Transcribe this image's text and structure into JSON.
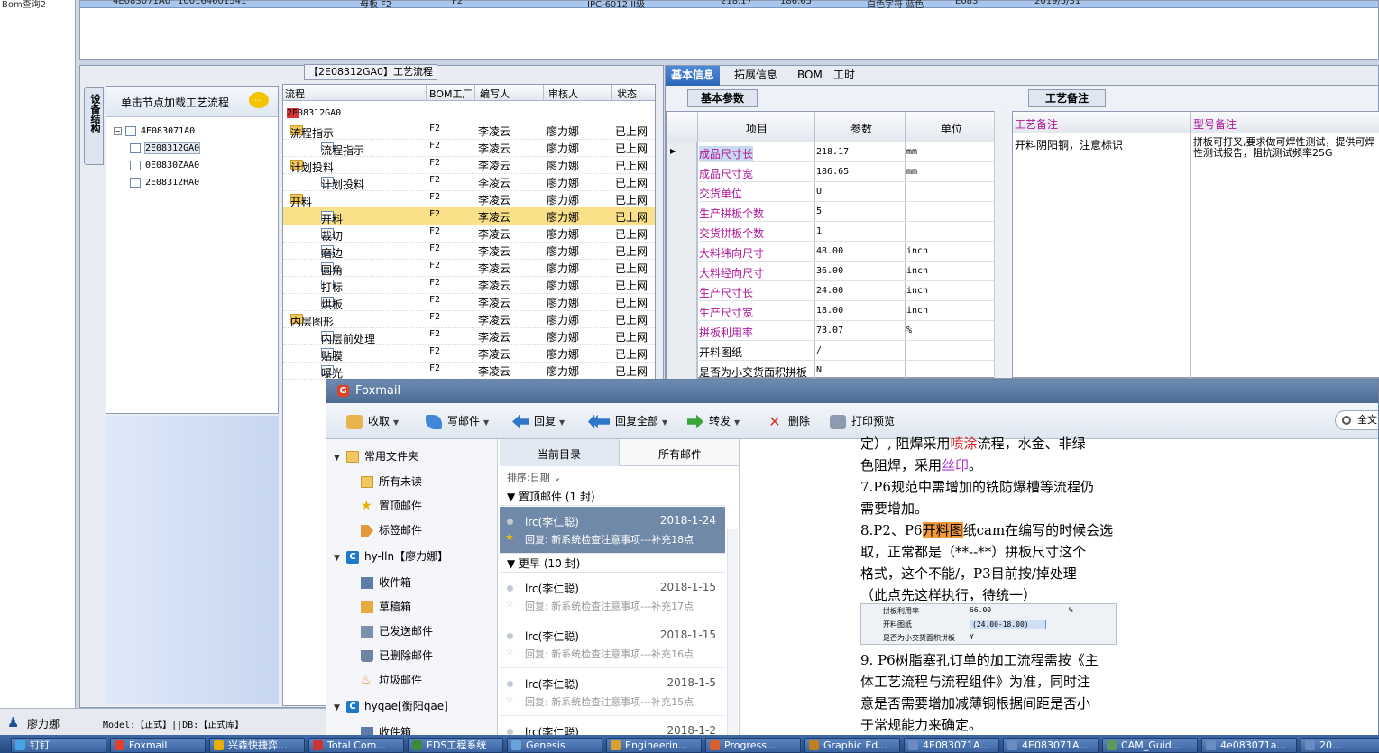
{
  "left_nav": {
    "label": "Bom查询2"
  },
  "top_grid": {
    "row": [
      "4E083071A0",
      "100164601541",
      "母板  F2",
      "F2",
      "IPC-6012 II级",
      "218.17",
      "186.65",
      "白色字符  蓝色",
      "E083",
      "2019/5/31"
    ]
  },
  "process_panel": {
    "title": "【2E08312GA0】工艺流程",
    "side_tab": "设备结构",
    "tree_header": "单击节点加载工艺流程",
    "tree_nodes": [
      "4E083071A0",
      "2E08312GA0",
      "0E0830ZAA0",
      "2E08312HA0"
    ],
    "grid_headers": [
      "流程",
      "BOM工厂",
      "编写人",
      "审核人",
      "状态"
    ],
    "root": "2E08312GA0",
    "rows": [
      {
        "name": "流程指示",
        "bom": "F2",
        "writer": "李凌云",
        "reviewer": "廖力娜",
        "status": "已上网",
        "kind": "folder",
        "level": 1
      },
      {
        "name": "流程指示",
        "bom": "F2",
        "writer": "李凌云",
        "reviewer": "廖力娜",
        "status": "已上网",
        "kind": "doc",
        "level": 2
      },
      {
        "name": "计划投料",
        "bom": "F2",
        "writer": "李凌云",
        "reviewer": "廖力娜",
        "status": "已上网",
        "kind": "folder",
        "level": 1
      },
      {
        "name": "计划投料",
        "bom": "F2",
        "writer": "李凌云",
        "reviewer": "廖力娜",
        "status": "已上网",
        "kind": "doc",
        "level": 2
      },
      {
        "name": "开料",
        "bom": "F2",
        "writer": "李凌云",
        "reviewer": "廖力娜",
        "status": "已上网",
        "kind": "folder",
        "level": 1
      },
      {
        "name": "开料",
        "bom": "F2",
        "writer": "李凌云",
        "reviewer": "廖力娜",
        "status": "已上网",
        "kind": "doc",
        "level": 2,
        "selected": true
      },
      {
        "name": "裁切",
        "bom": "F2",
        "writer": "李凌云",
        "reviewer": "廖力娜",
        "status": "已上网",
        "kind": "doc",
        "level": 2
      },
      {
        "name": "磨边",
        "bom": "F2",
        "writer": "李凌云",
        "reviewer": "廖力娜",
        "status": "已上网",
        "kind": "doc",
        "level": 2
      },
      {
        "name": "圆角",
        "bom": "F2",
        "writer": "李凌云",
        "reviewer": "廖力娜",
        "status": "已上网",
        "kind": "doc",
        "level": 2
      },
      {
        "name": "打标",
        "bom": "F2",
        "writer": "李凌云",
        "reviewer": "廖力娜",
        "status": "已上网",
        "kind": "doc",
        "level": 2
      },
      {
        "name": "烘板",
        "bom": "F2",
        "writer": "李凌云",
        "reviewer": "廖力娜",
        "status": "已上网",
        "kind": "doc",
        "level": 2
      },
      {
        "name": "内层图形",
        "bom": "F2",
        "writer": "李凌云",
        "reviewer": "廖力娜",
        "status": "已上网",
        "kind": "folder",
        "level": 1
      },
      {
        "name": "内层前处理",
        "bom": "F2",
        "writer": "李凌云",
        "reviewer": "廖力娜",
        "status": "已上网",
        "kind": "doc",
        "level": 2
      },
      {
        "name": "贴膜",
        "bom": "F2",
        "writer": "李凌云",
        "reviewer": "廖力娜",
        "status": "已上网",
        "kind": "doc",
        "level": 2
      },
      {
        "name": "曝光",
        "bom": "F2",
        "writer": "李凌云",
        "reviewer": "廖力娜",
        "status": "已上网",
        "kind": "doc",
        "level": 2
      }
    ]
  },
  "detail": {
    "tabs": [
      "基本信息",
      "拓展信息",
      "BOM",
      "工时"
    ],
    "section_title": "基本参数",
    "col_headers": [
      "项目",
      "参数",
      "单位"
    ],
    "params": [
      {
        "label": "成品尺寸长",
        "value": "218.17",
        "unit": "mm",
        "color": "purple"
      },
      {
        "label": "成品尺寸宽",
        "value": "186.65",
        "unit": "mm",
        "color": "purple"
      },
      {
        "label": "交货单位",
        "value": "U",
        "unit": "",
        "color": "purple"
      },
      {
        "label": "生产拼板个数",
        "value": "5",
        "unit": "",
        "color": "purple"
      },
      {
        "label": "交货拼板个数",
        "value": "1",
        "unit": "",
        "color": "purple"
      },
      {
        "label": "大料纬向尺寸",
        "value": "48.00",
        "unit": "inch",
        "color": "purple"
      },
      {
        "label": "大料经向尺寸",
        "value": "36.00",
        "unit": "inch",
        "color": "purple"
      },
      {
        "label": "生产尺寸长",
        "value": "24.00",
        "unit": "inch",
        "color": "purple"
      },
      {
        "label": "生产尺寸宽",
        "value": "18.00",
        "unit": "inch",
        "color": "purple"
      },
      {
        "label": "拼板利用率",
        "value": "73.07",
        "unit": "%",
        "color": "purple"
      },
      {
        "label": "开料图纸",
        "value": "/",
        "unit": "",
        "color": "black"
      },
      {
        "label": "是否为小交货面积拼板",
        "value": "N",
        "unit": "",
        "color": "black"
      }
    ],
    "notes_title": "工艺备注",
    "notes_headers": [
      "工艺备注",
      "型号备注"
    ],
    "process_note": "开料阴阳铜，注意标识",
    "model_note": "拼板可打叉,要求做可焊性测试，提供可焊性测试报告，阻抗测试频率25G"
  },
  "foxmail": {
    "title": "Foxmail",
    "toolbar": [
      "收取",
      "写邮件",
      "回复",
      "回复全部",
      "转发",
      "删除",
      "打印预览"
    ],
    "search_placeholder": "全文",
    "folders": {
      "common_group": "常用文件夹",
      "common": [
        "所有未读",
        "置顶邮件",
        "标签邮件"
      ],
      "account1": "hy-lln【廖力娜】",
      "account1_folders": [
        "收件箱",
        "草稿箱",
        "已发送邮件",
        "已删除邮件",
        "垃圾邮件"
      ],
      "account2": "hyqae[衡阳qae]",
      "account2_folders": [
        "收件箱"
      ]
    },
    "list_tabs": [
      "当前目录",
      "所有邮件"
    ],
    "sort_label": "排序:日期",
    "group_pinned": "置顶邮件 (1 封)",
    "group_earlier": "更早 (10 封)",
    "messages": [
      {
        "from": "lrc(李仁聪)",
        "date": "2018-1-24",
        "subject": "回复: 新系统检查注意事项---补充18点"
      },
      {
        "from": "lrc(李仁聪)",
        "date": "2018-1-15",
        "subject": "回复: 新系统检查注意事项---补充17点"
      },
      {
        "from": "lrc(李仁聪)",
        "date": "2018-1-15",
        "subject": "回复: 新系统检查注意事项---补充16点"
      },
      {
        "from": "lrc(李仁聪)",
        "date": "2018-1-5",
        "subject": "回复: 新系统检查注意事项---补充15点"
      },
      {
        "from": "lrc(李仁聪)",
        "date": "2018-1-2",
        "subject": ""
      }
    ],
    "reader": {
      "line1a": "定）, 阻焊采用",
      "line1b": "喷涂",
      "line1c": "流程，水金、非绿",
      "line2a": "色阻焊，采用",
      "line2b": "丝印",
      "line2c": "。",
      "line3": "7.P6规范中需增加的铣防爆槽等流程仍",
      "line4": "需要增加。",
      "line5a": "8.P2、P6",
      "line5b": "开料图",
      "line5c": "纸cam在编写的时候会选",
      "line6": "取，正常都是（**--**）拼板尺寸这个",
      "line7": "格式，这个不能/，P3目前按/掉处理",
      "line8": "（此点先这样执行，待统一）",
      "embed": [
        {
          "label": "拼板利用率",
          "value": "66.00",
          "unit": "%"
        },
        {
          "label": "开料图纸",
          "value": "(24.00-18.00)",
          "unit": ""
        },
        {
          "label": "是否为小交货面积拼板",
          "value": "Y",
          "unit": ""
        }
      ],
      "line9": "9. P6树脂塞孔订单的加工流程需按《主",
      "line10": "体工艺流程与流程组件》为准，同时注",
      "line11": "意是否需要增加减薄铜根据间距是否小",
      "line12": "于常规能力来确定。"
    }
  },
  "status": {
    "user": "廖力娜",
    "model": "Model:【正式】||DB:【正式库】"
  },
  "taskbar": [
    "钉钉",
    "Foxmail",
    "兴森快捷弈...",
    "Total Com...",
    "EDS工程系统",
    "Genesis",
    "Engineerin...",
    "Progress...",
    "Graphic Ed...",
    "4E083071A...",
    "4E083071A...",
    "CAM_Guid...",
    "4e083071a...",
    "20..."
  ]
}
